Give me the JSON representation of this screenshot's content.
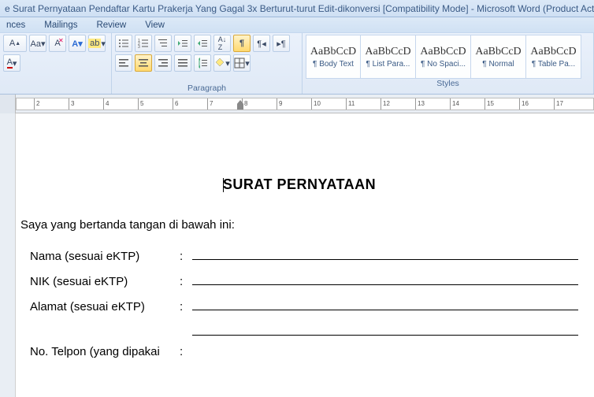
{
  "title": "e Surat Pernyataan Pendaftar Kartu Prakerja Yang Gagal 3x Berturut-turut Edit-dikonversi [Compatibility Mode]  -  Microsoft Word (Product Activat",
  "tabs": {
    "references": "nces",
    "mailings": "Mailings",
    "review": "Review",
    "view": "View"
  },
  "groups": {
    "font": "",
    "paragraph": "Paragraph",
    "styles": "Styles"
  },
  "styles": [
    {
      "preview": "AaBbCcD",
      "name": "¶ Body Text"
    },
    {
      "preview": "AaBbCcD",
      "name": "¶ List Para..."
    },
    {
      "preview": "AaBbCcD",
      "name": "¶ No Spaci..."
    },
    {
      "preview": "AaBbCcD",
      "name": "¶ Normal"
    },
    {
      "preview": "AaBbCcD",
      "name": "¶ Table Pa..."
    }
  ],
  "ruler": {
    "numbers": [
      2,
      3,
      4,
      5,
      6,
      7,
      8,
      9,
      10,
      11,
      12,
      13,
      14,
      15,
      16,
      17
    ]
  },
  "doc": {
    "heading": "SURAT PERNYATAAN",
    "intro": "Saya yang bertanda tangan di bawah ini:",
    "fields": [
      {
        "label": "Nama (sesuai eKTP)"
      },
      {
        "label": "NIK (sesuai eKTP)"
      },
      {
        "label": "Alamat (sesuai eKTP)"
      },
      {
        "label": "No. Telpon (yang dipakai"
      }
    ],
    "colon": ":"
  }
}
